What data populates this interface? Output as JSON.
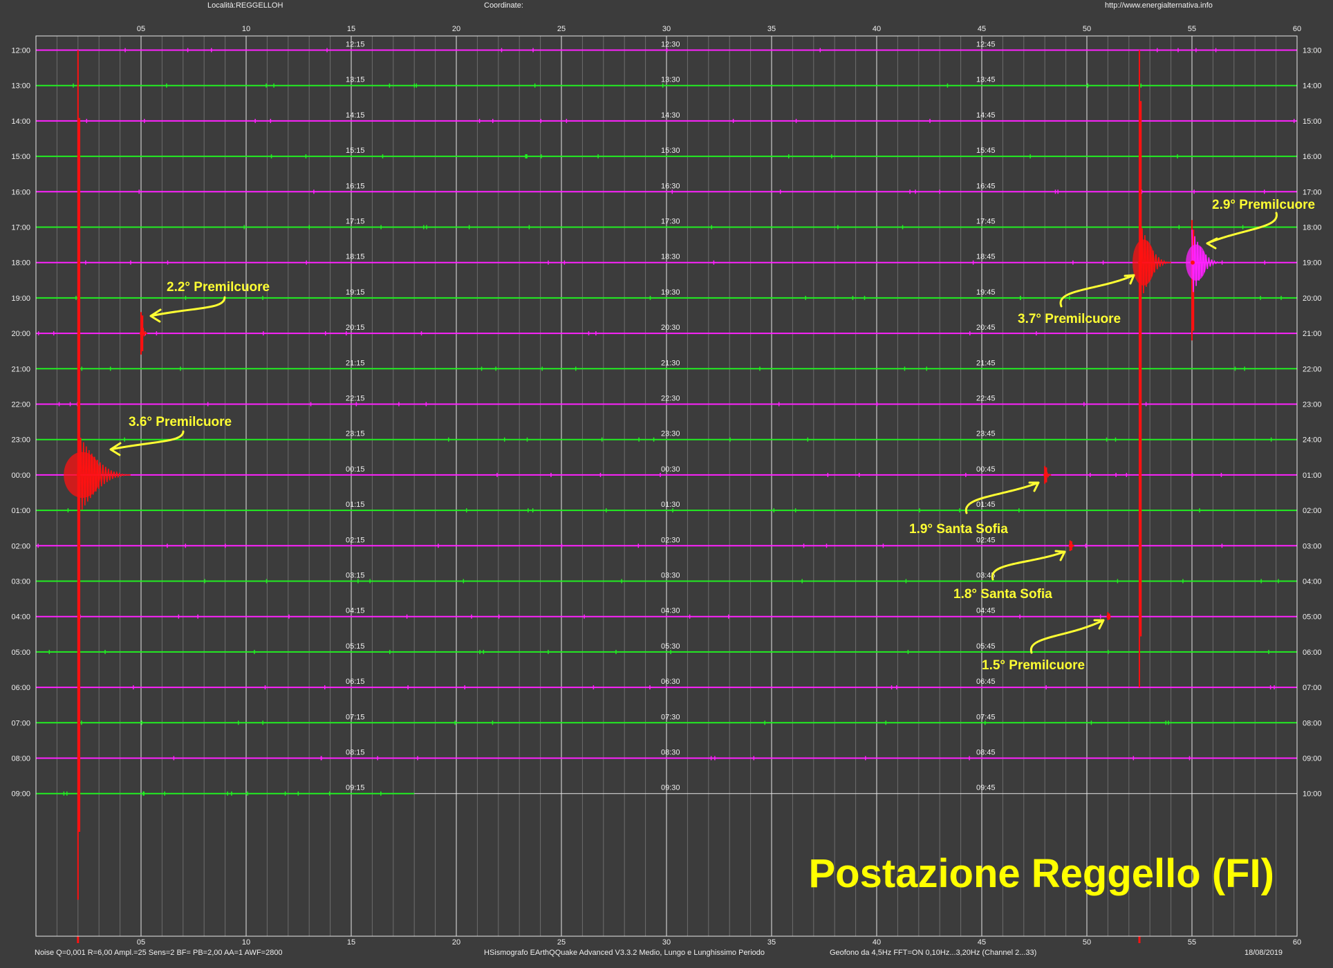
{
  "header": {
    "location": "Località:REGGELLOH",
    "coordinates": "Coordinate:",
    "url": "http://www.energialternativa.info"
  },
  "footer": {
    "left": "Noise Q=0,001 R=6,00 Ampl.=25 Sens=2 BF= PB=2,00 AA=1 AWF=2800",
    "center": "HSismografo  EArthQQuake Advanced V3.3.2  Medio, Lungo e Lunghissimo Periodo",
    "right": "Geofono da 4,5Hz FFT=ON 0,10Hz...3,20Hz      (Channel 2...33)",
    "date": "18/08/2019"
  },
  "station_title": "Postazione Reggello (FI)",
  "colors": {
    "background": "#3c3c3c",
    "trace_green": "#22ee22",
    "trace_magenta": "#ff22ff",
    "event_red": "#ff1111",
    "annotation": "#ffff33",
    "grid_major": "#e8e8e8",
    "grid_minor": "#6e6e6e"
  },
  "chart_data": {
    "type": "seismogram",
    "x_unit": "minutes",
    "xlim": [
      0,
      60
    ],
    "x_tick_labels": [
      "05",
      "10",
      "15",
      "20",
      "25",
      "30",
      "35",
      "40",
      "45",
      "50",
      "55",
      "60"
    ],
    "left_hour_labels": [
      "12:00",
      "13:00",
      "14:00",
      "15:00",
      "16:00",
      "17:00",
      "18:00",
      "19:00",
      "20:00",
      "21:00",
      "22:00",
      "23:00",
      "00:00",
      "01:00",
      "02:00",
      "03:00",
      "04:00",
      "05:00",
      "06:00",
      "07:00",
      "08:00",
      "09:00"
    ],
    "right_hour_labels": [
      "13:00",
      "14:00",
      "15:00",
      "16:00",
      "17:00",
      "18:00",
      "19:00",
      "20:00",
      "21:00",
      "22:00",
      "23:00",
      "24:00",
      "01:00",
      "02:00",
      "03:00",
      "04:00",
      "05:00",
      "06:00",
      "07:00",
      "08:00",
      "09:00",
      "10:00"
    ],
    "quarter_labels": [
      [
        "12:15",
        "12:30",
        "12:45"
      ],
      [
        "13:15",
        "13:30",
        "13:45"
      ],
      [
        "14:15",
        "14:30",
        "14:45"
      ],
      [
        "15:15",
        "15:30",
        "15:45"
      ],
      [
        "16:15",
        "16:30",
        "16:45"
      ],
      [
        "17:15",
        "17:30",
        "17:45"
      ],
      [
        "18:15",
        "18:30",
        "18:45"
      ],
      [
        "19:15",
        "19:30",
        "19:45"
      ],
      [
        "20:15",
        "20:30",
        "20:45"
      ],
      [
        "21:15",
        "21:30",
        "21:45"
      ],
      [
        "22:15",
        "22:30",
        "22:45"
      ],
      [
        "23:15",
        "23:30",
        "23:45"
      ],
      [
        "00:15",
        "00:30",
        "00:45"
      ],
      [
        "01:15",
        "01:30",
        "01:45"
      ],
      [
        "02:15",
        "02:30",
        "02:45"
      ],
      [
        "03:15",
        "03:30",
        "03:45"
      ],
      [
        "04:15",
        "04:30",
        "04:45"
      ],
      [
        "05:15",
        "05:30",
        "05:45"
      ],
      [
        "06:15",
        "06:30",
        "06:45"
      ],
      [
        "07:15",
        "07:30",
        "07:45"
      ],
      [
        "08:15",
        "08:30",
        "08:45"
      ],
      [
        "09:15",
        "09:30",
        "09:45"
      ]
    ],
    "last_row_recorded_until_minute": 18,
    "events": [
      {
        "row": 12,
        "minute": 2.0,
        "peak_row_span": [
          -12,
          12
        ],
        "coda_minutes": 2.5,
        "label": "3.6° Premilcuore"
      },
      {
        "row": 8,
        "minute": 5.0,
        "peak_row_span": [
          -0.6,
          0.6
        ],
        "coda_minutes": 0.3,
        "label": "2.2° Premilcuore"
      },
      {
        "row": 6,
        "minute": 52.5,
        "peak_row_span": [
          -6,
          12
        ],
        "coda_minutes": 1.5,
        "label": "3.7° Premilcuore"
      },
      {
        "row": 6,
        "minute": 55.0,
        "peak_row_span": [
          -1.2,
          2.2
        ],
        "coda_minutes": 1.4,
        "label": "2.9° Premilcuore"
      },
      {
        "row": 12,
        "minute": 48.0,
        "peak_row_span": [
          -0.25,
          0.25
        ],
        "coda_minutes": 0.3,
        "label": "1.9° Santa Sofia"
      },
      {
        "row": 14,
        "minute": 49.2,
        "peak_row_span": [
          -0.15,
          0.15
        ],
        "coda_minutes": 0.2,
        "label": "1.8° Santa Sofia"
      },
      {
        "row": 16,
        "minute": 51.0,
        "peak_row_span": [
          -0.1,
          0.1
        ],
        "coda_minutes": 0.1,
        "label": "1.5° Premilcuore"
      }
    ]
  }
}
